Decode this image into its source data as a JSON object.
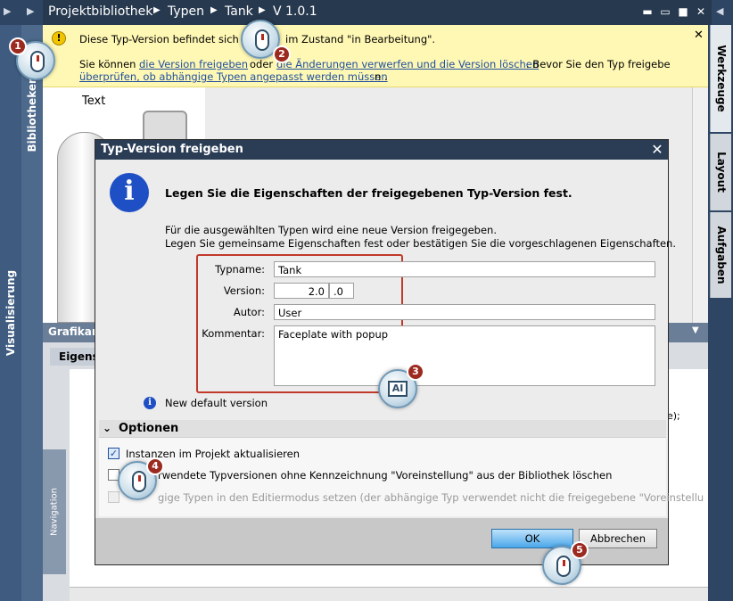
{
  "left_tabs": {
    "visualisierung": "Visualisierung",
    "bibliotheken": "Bibliotheken"
  },
  "breadcrumb": {
    "items": [
      "Projektbibliothek",
      "Typen",
      "Tank",
      "V 1.0.1"
    ]
  },
  "infobar": {
    "line1": "Diese Typ-Version befindet sich mo",
    "line1_end": "im Zustand \"in Bearbeitung\".",
    "line2_pre": "Sie können",
    "link_release": "die Version freigeben",
    "line2_mid": "oder",
    "link_discard": "die Änderungen verwerfen und die Version löschen",
    "line2_post": ". Bevor Sie den Typ freigebe",
    "link_check": "überprüfen, ob abhängige Typen angepasst werden müssen",
    "line3_post": "n ."
  },
  "editor": {
    "text_label": "Text"
  },
  "grafik": {
    "title": "Grafikan",
    "tab": "Eigens",
    "nav": "Navigation",
    "code_tail": "e);"
  },
  "right_tabs": {
    "werkzeuge": "Werkzeuge",
    "layout": "Layout",
    "aufgaben": "Aufgaben"
  },
  "dialog": {
    "title": "Typ-Version freigeben",
    "heading": "Legen Sie die Eigenschaften der freigegebenen Typ-Version fest.",
    "desc1": "Für die ausgewählten Typen wird eine neue Version freigegeben.",
    "desc2": "Legen Sie gemeinsame Eigenschaften fest oder bestätigen Sie die vorgeschlagenen Eigenschaften.",
    "fields": {
      "typname_label": "Typname:",
      "typname_value": "Tank",
      "version_label": "Version:",
      "version_major": "2.0",
      "version_minor": ".0",
      "autor_label": "Autor:",
      "autor_value": "User",
      "kommentar_label": "Kommentar:",
      "kommentar_value": "Faceplate with popup"
    },
    "info_note": "New default version",
    "options_header": "Optionen",
    "options": [
      {
        "label": "Instanzen im Projekt aktualisieren",
        "checked": true
      },
      {
        "label": "rwendete Typversionen ohne Kennzeichnung \"Voreinstellung\" aus der Bibliothek löschen",
        "checked": false
      },
      {
        "label": "gige Typen in den Editiermodus setzen (der abhängige Typ verwendet nicht die freigegebene \"Voreinstellu",
        "checked": false
      }
    ],
    "ok_label": "OK",
    "cancel_label": "Abbrechen"
  },
  "markers": [
    "1",
    "2",
    "3",
    "4",
    "5"
  ],
  "colors": {
    "titlebar": "#2b3d55",
    "infobar": "#fff8b4",
    "badge": "#9c2a1f",
    "highlight_box": "#c0392b",
    "ok_button": "#4aa7ea"
  }
}
